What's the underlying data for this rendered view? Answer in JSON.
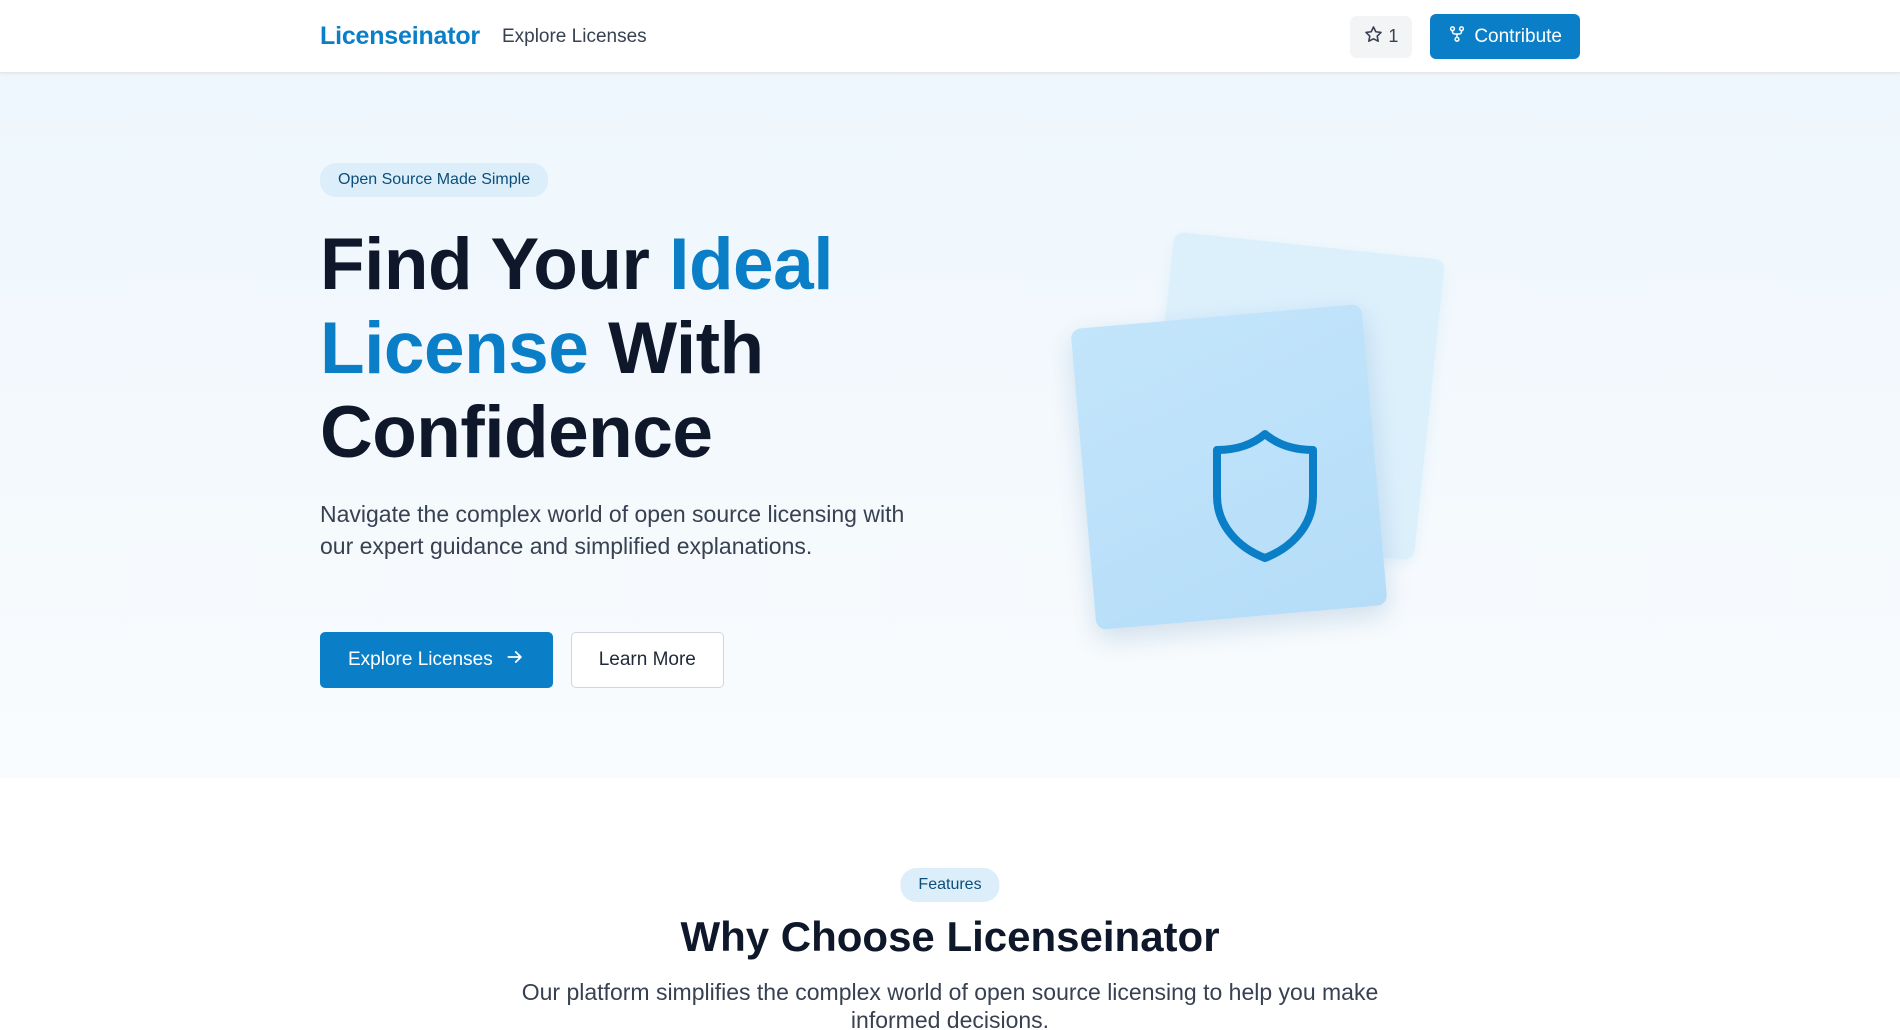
{
  "nav": {
    "logo": "Licenseinator",
    "explore_link": "Explore Licenses",
    "star_count": "1",
    "contribute_label": "Contribute"
  },
  "hero": {
    "badge": "Open Source Made Simple",
    "headline": {
      "part1": "Find Your ",
      "accent1": "Ideal",
      "accent2": "License",
      "part2": " With",
      "part3": "Confidence"
    },
    "description": "Navigate the complex world of open source licensing with our expert guidance and simplified explanations.",
    "primary_button": "Explore Licenses",
    "secondary_button": "Learn More"
  },
  "features": {
    "badge": "Features",
    "title": "Why Choose Licenseinator",
    "description": "Our platform simplifies the complex world of open source licensing to help you make informed decisions."
  },
  "colors": {
    "accent": "#0a7fc7",
    "heading": "#0f172a",
    "pill_bg": "#dbeefa"
  },
  "icons": {
    "star": "star-icon",
    "contribute": "git-fork-icon",
    "arrow": "arrow-right-icon",
    "shield": "shield-icon"
  }
}
